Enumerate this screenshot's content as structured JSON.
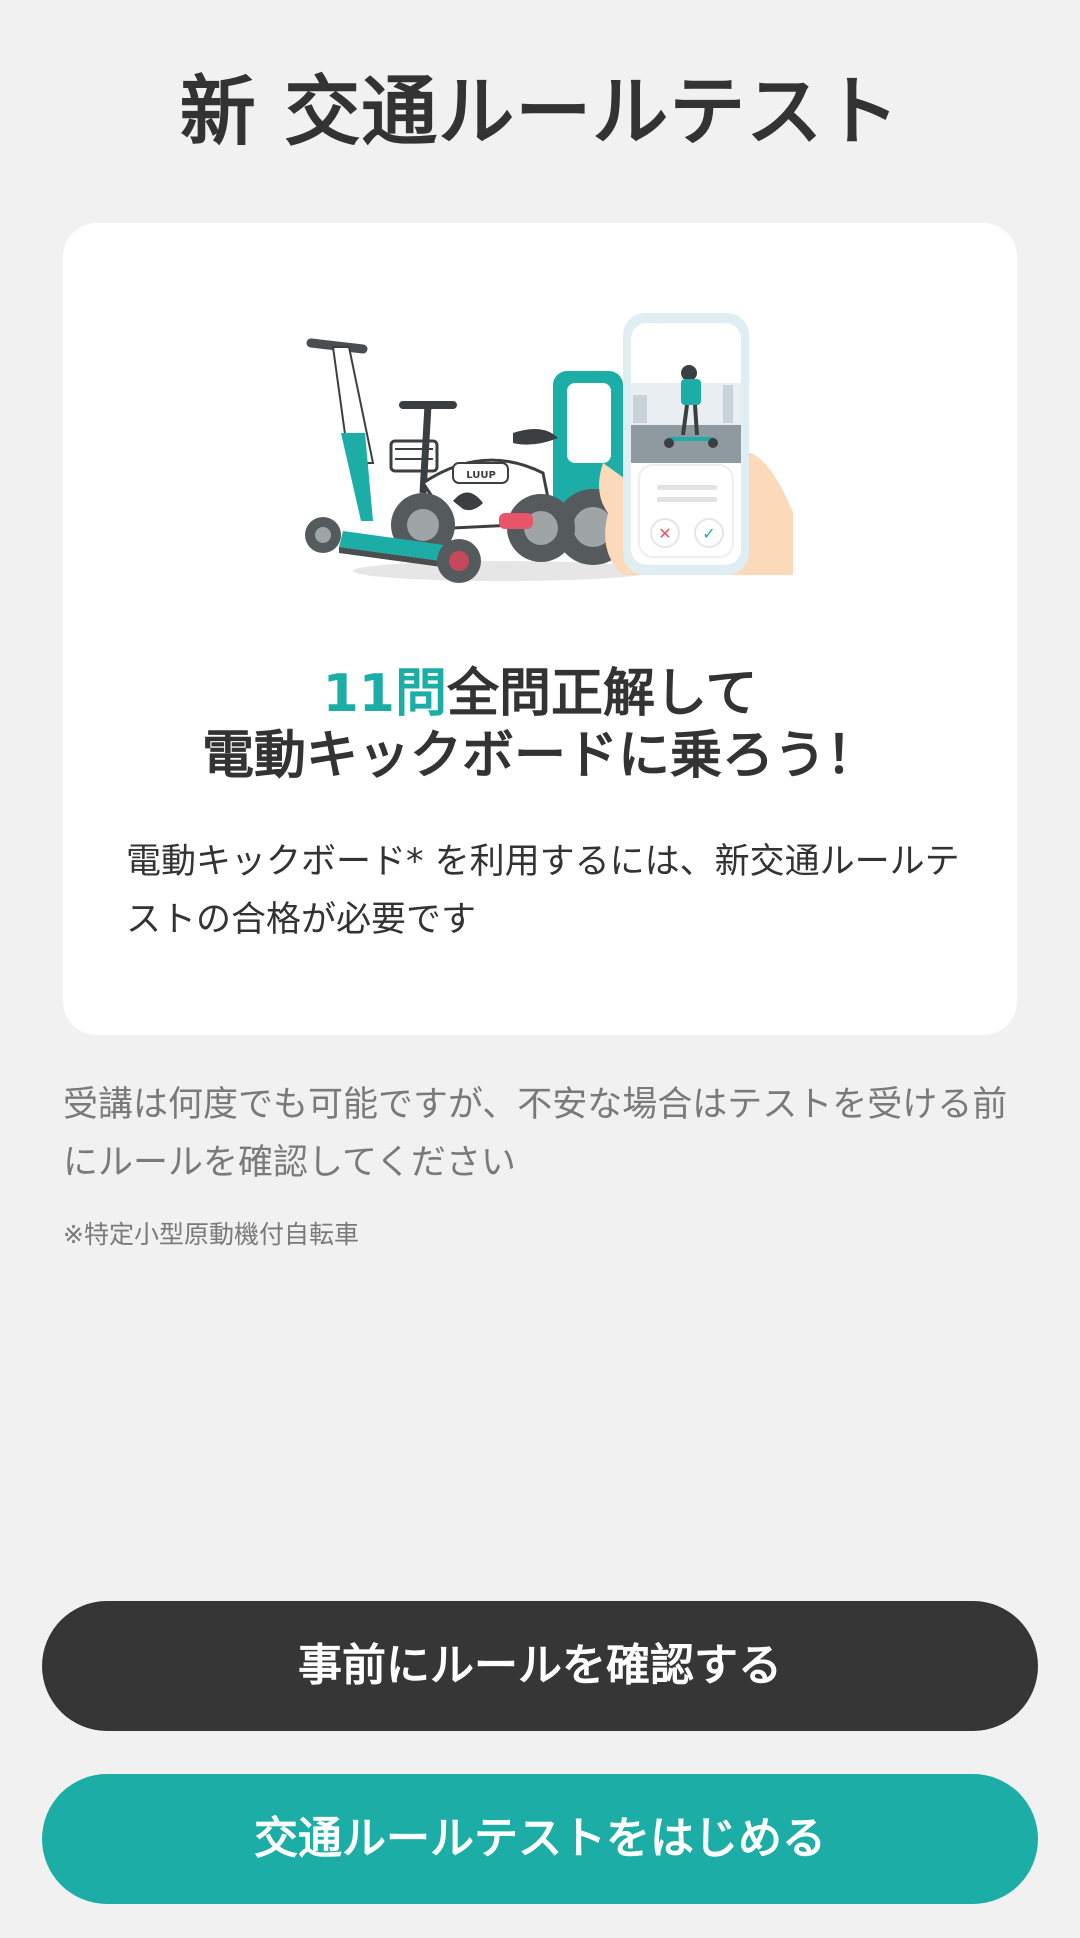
{
  "page": {
    "title": "新 交通ルールテスト"
  },
  "card": {
    "headline_accent": "11問",
    "headline_rest": "全問正解して",
    "headline_line2": "電動キックボードに乗ろう！",
    "description": "電動キックボード* を利用するには、新交通ルールテストの合格が必要です",
    "illustration": {
      "brand_label": "LUUP",
      "icons": [
        "scooter-icon",
        "bicycle-icon",
        "cabin-vehicle-icon",
        "phone-in-hand-icon",
        "cross-icon",
        "check-icon"
      ]
    }
  },
  "note": "受講は何度でも可能ですが、不安な場合はテストを受ける前にルールを確認してください",
  "footnote": "※特定小型原動機付自転車",
  "buttons": {
    "confirm_rules": "事前にルールを確認する",
    "start_test": "交通ルールテストをはじめる"
  },
  "colors": {
    "accent": "#1bada6",
    "dark_button": "#363636",
    "background": "#f1f1f1",
    "card": "#ffffff"
  }
}
